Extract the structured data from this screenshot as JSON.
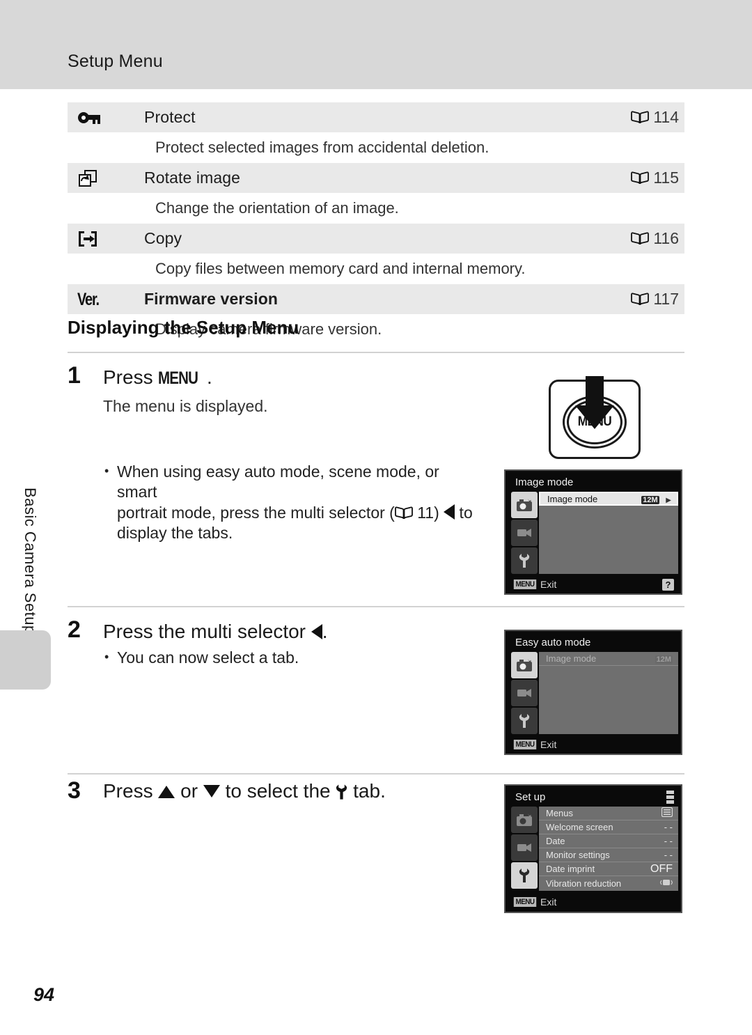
{
  "header": {
    "title": "Setup Menu"
  },
  "menu_table": {
    "rows": [
      {
        "icon": "key-icon",
        "label": "Protect",
        "ref_page": "114",
        "description": "Protect selected images from accidental deletion.",
        "bold": false
      },
      {
        "icon": "rotate-image-icon",
        "label": "Rotate image",
        "ref_page": "115",
        "description": "Change the orientation of an image.",
        "bold": false
      },
      {
        "icon": "copy-icon",
        "label": "Copy",
        "ref_page": "116",
        "description": "Copy files between memory card and internal memory.",
        "bold": false
      },
      {
        "icon": "firmware-version-icon",
        "label": "Firmware version",
        "ref_page": "117",
        "description": "Display camera firmware version.",
        "bold": true,
        "icon_text": "Ver."
      }
    ]
  },
  "section": {
    "heading": "Displaying the Setup Menu"
  },
  "steps": [
    {
      "number": "1",
      "title_prefix": "Press ",
      "title_menu_word": "MENU",
      "title_suffix": ".",
      "sub": "The menu is displayed.",
      "bullet": {
        "line1": "When using easy auto mode, scene mode, or smart",
        "line2_a": "portrait mode, press the multi selector (",
        "line2_ref": "11",
        "line2_b": ") ",
        "line2_c": " to",
        "line3": "display the tabs."
      }
    },
    {
      "number": "2",
      "title_prefix": "Press the multi selector ",
      "title_suffix": ".",
      "sub_bullet": "You can now select a tab."
    },
    {
      "number": "3",
      "title_a": "Press ",
      "title_b": " or ",
      "title_c": " to select the ",
      "title_d": " tab."
    }
  ],
  "menu_button_art": {
    "label": "MENU",
    "name": "menu-button-illustration"
  },
  "lcd_screens": [
    {
      "name": "lcd-image-mode",
      "title": "Image mode",
      "tabs": [
        "shooting-tab-icon",
        "movie-tab-icon",
        "setup-tab-icon"
      ],
      "selected_tab": 0,
      "rows": [
        {
          "label": "Image mode",
          "value": "12M",
          "highlighted": true,
          "has_arrow": true
        }
      ],
      "footer": {
        "chip": "MENU",
        "label": "Exit"
      },
      "help_badge": "?"
    },
    {
      "name": "lcd-easy-auto-mode",
      "title": "Easy auto mode",
      "tabs": [
        "shooting-tab-icon",
        "movie-tab-icon",
        "setup-tab-icon"
      ],
      "selected_tab": 0,
      "rows": [
        {
          "label": "Image mode",
          "value": "12M",
          "highlighted": false,
          "has_arrow": false
        }
      ],
      "footer": {
        "chip": "MENU",
        "label": "Exit"
      },
      "help_badge": ""
    },
    {
      "name": "lcd-set-up",
      "title": "Set up",
      "tabs": [
        "shooting-tab-icon",
        "movie-tab-icon",
        "setup-tab-icon"
      ],
      "selected_tab": 2,
      "rows": [
        {
          "label": "Menus",
          "value": "menus-icon",
          "highlighted": false
        },
        {
          "label": "Welcome screen",
          "value": "- -",
          "highlighted": false
        },
        {
          "label": "Date",
          "value": "- -",
          "highlighted": false
        },
        {
          "label": "Monitor settings",
          "value": "- -",
          "highlighted": false
        },
        {
          "label": "Date imprint",
          "value": "OFF",
          "highlighted": false
        },
        {
          "label": "Vibration reduction",
          "value": "vr-icon",
          "highlighted": false
        }
      ],
      "footer": {
        "chip": "MENU",
        "label": "Exit"
      },
      "help_badge": ""
    }
  ],
  "side_tab": {
    "label": "Basic Camera Setup"
  },
  "page_number": "94",
  "colors": {
    "header_band": "#d8d8d8",
    "row_band": "#e9e9e9",
    "side_tab": "#cfcfcf"
  }
}
